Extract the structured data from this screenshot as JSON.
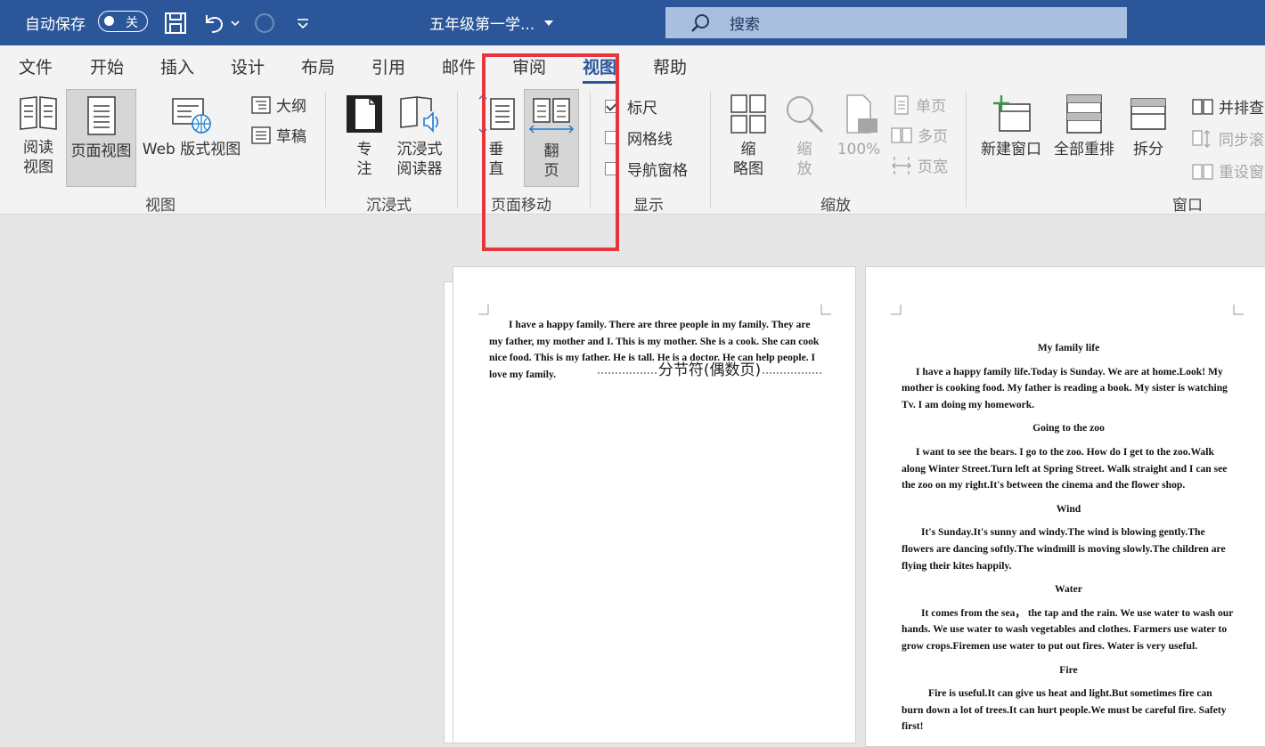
{
  "titlebar": {
    "autosave_label": "自动保存",
    "autosave_state": "关",
    "doc_title": "五年级第一学...",
    "search_placeholder": "搜索"
  },
  "menu": {
    "tabs": [
      "文件",
      "开始",
      "插入",
      "设计",
      "布局",
      "引用",
      "邮件",
      "审阅",
      "视图",
      "帮助"
    ],
    "active": "视图"
  },
  "ribbon": {
    "groups": {
      "views": "视图",
      "immersive": "沉浸式",
      "page_movement": "页面移动",
      "show": "显示",
      "zoom": "缩放",
      "window": "窗口"
    },
    "views": {
      "read_mode": [
        "阅读",
        "视图"
      ],
      "print_layout": "页面视图",
      "web_layout": "Web 版式视图",
      "outline": "大纲",
      "draft": "草稿"
    },
    "immersive": {
      "focus": [
        "专",
        "注"
      ],
      "reader": [
        "沉浸式",
        "阅读器"
      ]
    },
    "page_movement": {
      "vertical": [
        "垂",
        "直"
      ],
      "side_to_side": [
        "翻",
        "页"
      ]
    },
    "show": {
      "ruler": "标尺",
      "gridlines": "网格线",
      "nav_pane": "导航窗格"
    },
    "zoom": {
      "thumbnails": [
        "缩",
        "略图"
      ],
      "zoom": [
        "缩",
        "放"
      ],
      "hundred": "100%",
      "one_page": "单页",
      "multi_page": "多页",
      "page_width": "页宽"
    },
    "window": {
      "new_window": "新建窗口",
      "arrange_all": "全部重排",
      "split": "拆分",
      "side_by_side": "并排查",
      "sync_scroll": "同步滚",
      "reset_pos": "重设窗"
    }
  },
  "pages": {
    "left": {
      "para": "I have a happy family. There are three people in my family. They are my father, my mother and I. This is my mother. She is a cook. She can cook nice food. This is my father. He is tall. He is a doctor. He can help people. I love my family.",
      "section_break": "分节符(偶数页)"
    },
    "right": {
      "sections": [
        {
          "title": "My family life",
          "text": "I have a happy family life.Today is Sunday. We are at home.Look! My mother is cooking food. My father is reading a book. My sister is watching Tv. I am doing my homework."
        },
        {
          "title": "Going to the zoo",
          "text": "I want to see the bears. I go to the zoo. How do I get to the zoo.Walk along Winter Street.Turn left at Spring Street. Walk straight and I can see the zoo on my right.It's between the cinema and the flower shop."
        },
        {
          "title": "Wind",
          "text": "It's Sunday.It's sunny and windy.The wind is blowing gently.The flowers are dancing softly.The windmill is moving slowly.The children are flying their kites happily."
        },
        {
          "title": "Water",
          "text": "It comes from the sea， the tap and the rain. We use water to wash our hands. We use water to wash vegetables and clothes. Farmers use water to grow crops.Firemen use water to put out fires. Water is very useful."
        },
        {
          "title": "Fire",
          "text": "Fire is useful.It can give us heat and light.But sometimes fire can burn down a lot of trees.It can hurt people.We must be careful fire. Safety first!"
        }
      ]
    }
  }
}
